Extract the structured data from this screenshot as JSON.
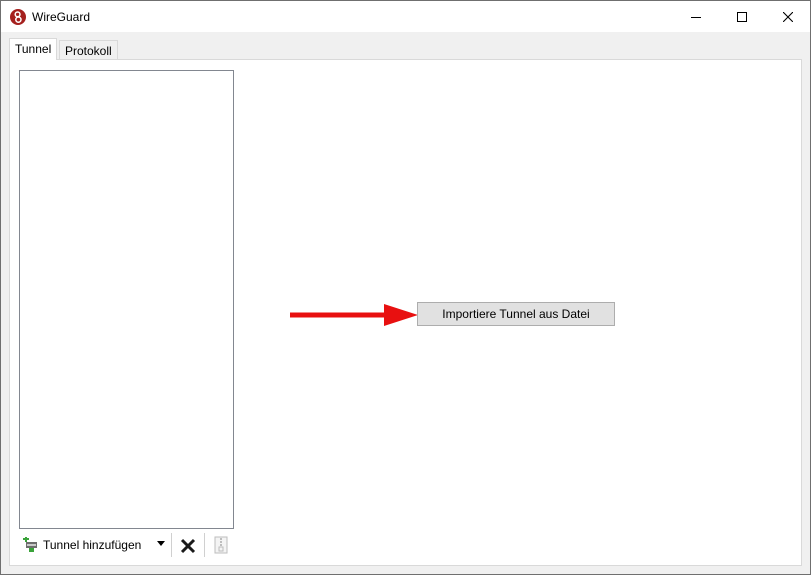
{
  "window": {
    "title": "WireGuard",
    "icon": "wireguard-logo-icon",
    "controls": [
      "minimize-icon",
      "maximize-icon",
      "close-icon"
    ]
  },
  "tabs": [
    {
      "label": "Tunnel",
      "active": true
    },
    {
      "label": "Protokoll",
      "active": false
    }
  ],
  "sidebar": {
    "tunnels": [],
    "toolbar": {
      "add_label": "Tunnel hinzufügen",
      "add_icon": "add-tunnel-icon",
      "dropdown_icon": "chevron-down-icon",
      "delete_icon": "delete-icon",
      "export_icon": "export-zip-icon"
    }
  },
  "main": {
    "import_button_label": "Importiere Tunnel aus Datei",
    "annotation": {
      "type": "arrow",
      "color": "#e81010"
    }
  },
  "colors": {
    "logo_red": "#a5201e",
    "annotation_red": "#e81010",
    "add_icon_green": "#3aa33a"
  }
}
